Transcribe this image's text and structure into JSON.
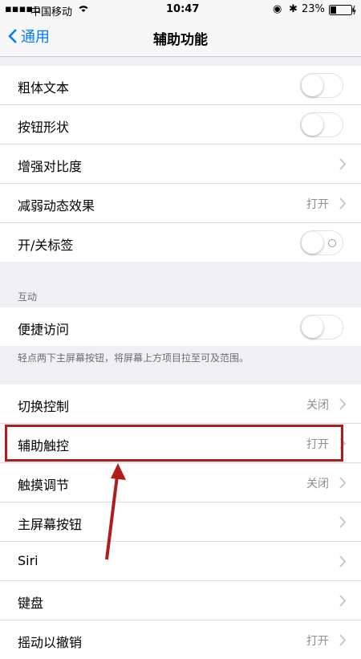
{
  "status_bar": {
    "carrier": "中国移动",
    "time": "10:47",
    "battery": "23%"
  },
  "nav": {
    "back_label": "通用",
    "title": "辅助功能"
  },
  "group1": [
    {
      "label": "粗体文本",
      "control": "toggle"
    },
    {
      "label": "按钮形状",
      "control": "toggle"
    },
    {
      "label": "增强对比度",
      "control": "chevron"
    },
    {
      "label": "减弱动态效果",
      "value": "打开",
      "control": "chevron"
    },
    {
      "label": "开/关标签",
      "control": "toggle-label"
    }
  ],
  "section_interaction": {
    "header": "互动",
    "row_label": "便捷访问",
    "footer": "轻点两下主屏幕按钮，将屏幕上方项目拉至可及范围。"
  },
  "group3": [
    {
      "label": "切换控制",
      "value": "关闭"
    },
    {
      "label": "辅助触控",
      "value": "打开"
    },
    {
      "label": "触摸调节",
      "value": "关闭"
    },
    {
      "label": "主屏幕按钮",
      "value": ""
    },
    {
      "label": "Siri",
      "value": ""
    },
    {
      "label": "键盘",
      "value": ""
    },
    {
      "label": "摇动以撤销",
      "value": "打开"
    }
  ],
  "colors": {
    "accent": "#007aff",
    "highlight_box": "#b11c1c"
  }
}
